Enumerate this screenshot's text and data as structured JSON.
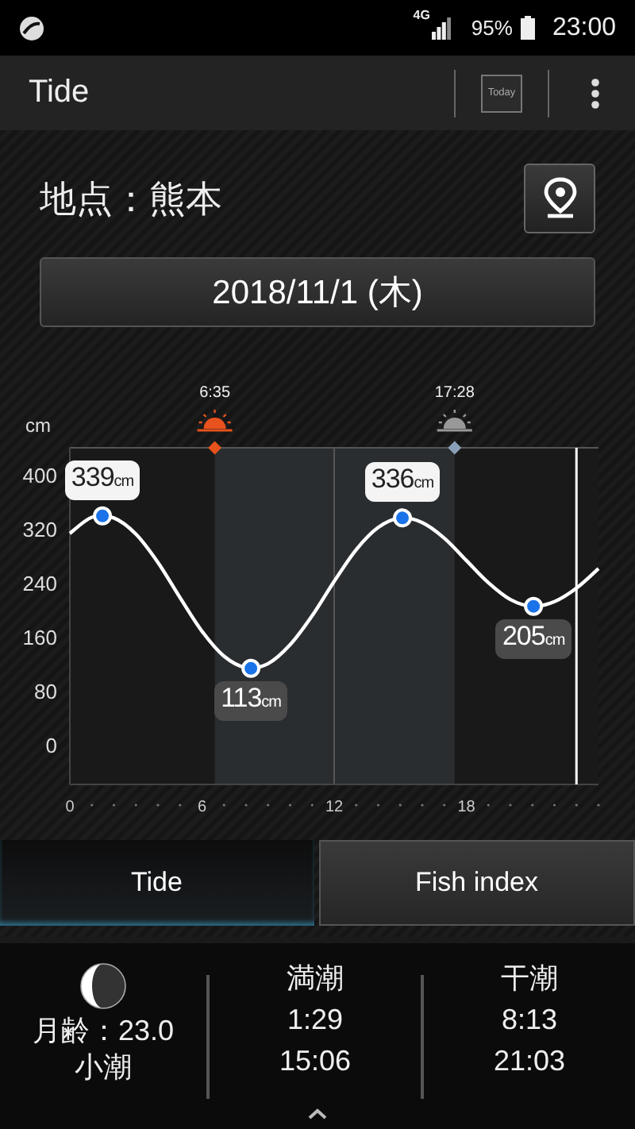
{
  "status_bar": {
    "network": "4G",
    "battery": "95%",
    "time": "23:00"
  },
  "app_bar": {
    "title": "Tide",
    "today_button": "Today"
  },
  "location": {
    "label": "地点：熊本"
  },
  "date_button": "2018/11/1 (木)",
  "chart": {
    "chart_data": {
      "type": "line",
      "ylabel": "cm",
      "x": [
        0,
        1,
        2,
        3,
        4,
        5,
        6,
        7,
        8,
        9,
        10,
        11,
        12,
        13,
        14,
        15,
        16,
        17,
        18,
        19,
        20,
        21,
        22,
        23,
        24
      ],
      "xlim": [
        0,
        24
      ],
      "ylim": [
        -59,
        440
      ],
      "xticks": [
        0,
        6,
        12,
        18
      ],
      "yticks": [
        0,
        80,
        160,
        240,
        320,
        400
      ],
      "series": [
        {
          "color": "#ffffff",
          "values": [
            313,
            337,
            336,
            312,
            270,
            218,
            168,
            131,
            114,
            120,
            148,
            191,
            242,
            289,
            322,
            336,
            329,
            306,
            273,
            240,
            215,
            205,
            212,
            232,
            261
          ]
        }
      ],
      "bands": [
        {
          "axis": "x",
          "from": 6.58,
          "to": 17.47
        }
      ],
      "ref_lines": [
        {
          "axis": "x",
          "value": 23
        }
      ],
      "annotations": [
        {
          "x": 1.48,
          "y": 339,
          "text": "339cm"
        },
        {
          "x": 8.22,
          "y": 113,
          "text": "113cm"
        },
        {
          "x": 15.1,
          "y": 336,
          "text": "336cm"
        },
        {
          "x": 21.05,
          "y": 205,
          "text": "205cm"
        }
      ]
    },
    "sun_events": [
      {
        "kind": "sunrise",
        "time": "6:35"
      },
      {
        "kind": "sunset",
        "time": "17:28"
      }
    ]
  },
  "tabs": [
    {
      "label": "Tide",
      "selected": true
    },
    {
      "label": "Fish index",
      "selected": false
    }
  ],
  "summary": {
    "moon_age": "月齢：23.0",
    "tide_name": "小潮",
    "columns": [
      {
        "heading": "満潮",
        "times": [
          "1:29",
          "15:06"
        ]
      },
      {
        "heading": "干潮",
        "times": [
          "8:13",
          "21:03"
        ]
      }
    ]
  }
}
